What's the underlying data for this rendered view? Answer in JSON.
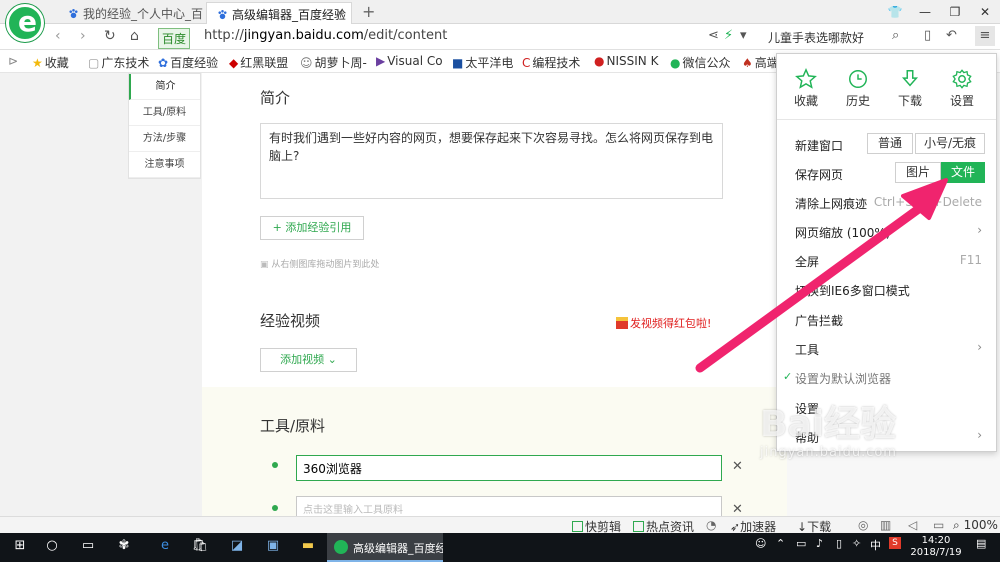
{
  "browser": {
    "tabs": [
      {
        "label": "我的经验_个人中心_百",
        "active": false
      },
      {
        "label": "高级编辑器_百度经验",
        "active": true
      }
    ],
    "new_tab": "+",
    "address": {
      "badge": "百度",
      "url_prefix": "http://",
      "domain": "jingyan.baidu.com",
      "path": "/edit/content"
    },
    "search_hint": "儿童手表选哪款好",
    "bookmarks": [
      "收藏",
      "广东技术",
      "百度经验",
      "红黑联盟",
      "胡萝卜周-",
      "Visual Co",
      "太平洋电",
      "编程技术",
      "NISSIN K",
      "微信公众",
      "高端"
    ]
  },
  "left_nav": [
    "简介",
    "工具/原料",
    "方法/步骤",
    "注意事项"
  ],
  "editor": {
    "intro_title": "简介",
    "intro_text": "有时我们遇到一些好内容的网页，想要保存起来下次容易寻找。怎么将网页保存到电脑上?",
    "add_ref_label": "+ 添加经验引用",
    "drag_hint": "从右侧图库拖动图片到此处",
    "video_title": "经验视频",
    "video_promo": "发视频得红包啦!",
    "add_video_label": "添加视频",
    "tools_title": "工具/原料",
    "tool_1": "360浏览器",
    "tool_placeholder": "点击这里输入工具原料"
  },
  "menu": {
    "quick": [
      {
        "label": "收藏",
        "icon": "star-icon"
      },
      {
        "label": "历史",
        "icon": "clock-icon"
      },
      {
        "label": "下载",
        "icon": "download-icon"
      },
      {
        "label": "设置",
        "icon": "gear-icon"
      }
    ],
    "new_window": "新建窗口",
    "new_window_normal": "普通",
    "new_window_private": "小号/无痕",
    "save_page": "保存网页",
    "save_image": "图片",
    "save_file": "文件",
    "clear_traces": "清除上网痕迹",
    "clear_shortcut": "Ctrl+Shift+Delete",
    "zoom": "网页缩放 (100%)",
    "fullscreen": "全屏",
    "fullscreen_key": "F11",
    "ie6_mode": "切换到IE6多窗口模式",
    "ad_block": "广告拦截",
    "tools": "工具",
    "set_default": "设置为默认浏览器",
    "settings": "设置",
    "help": "帮助"
  },
  "statusbar": {
    "quick_clip": "快剪辑",
    "hot_news": "热点资讯",
    "accelerator": "加速器",
    "download": "下载",
    "zoom": "100%"
  },
  "taskbar": {
    "active_app": "高级编辑器_百度经...",
    "ime": "中",
    "time": "14:20",
    "date": "2018/7/19"
  },
  "watermark": {
    "brand": "Bai经验",
    "domain": "jingyan.baidu.com"
  },
  "colors": {
    "accent": "#21b457",
    "annotation": "#f0246e"
  }
}
